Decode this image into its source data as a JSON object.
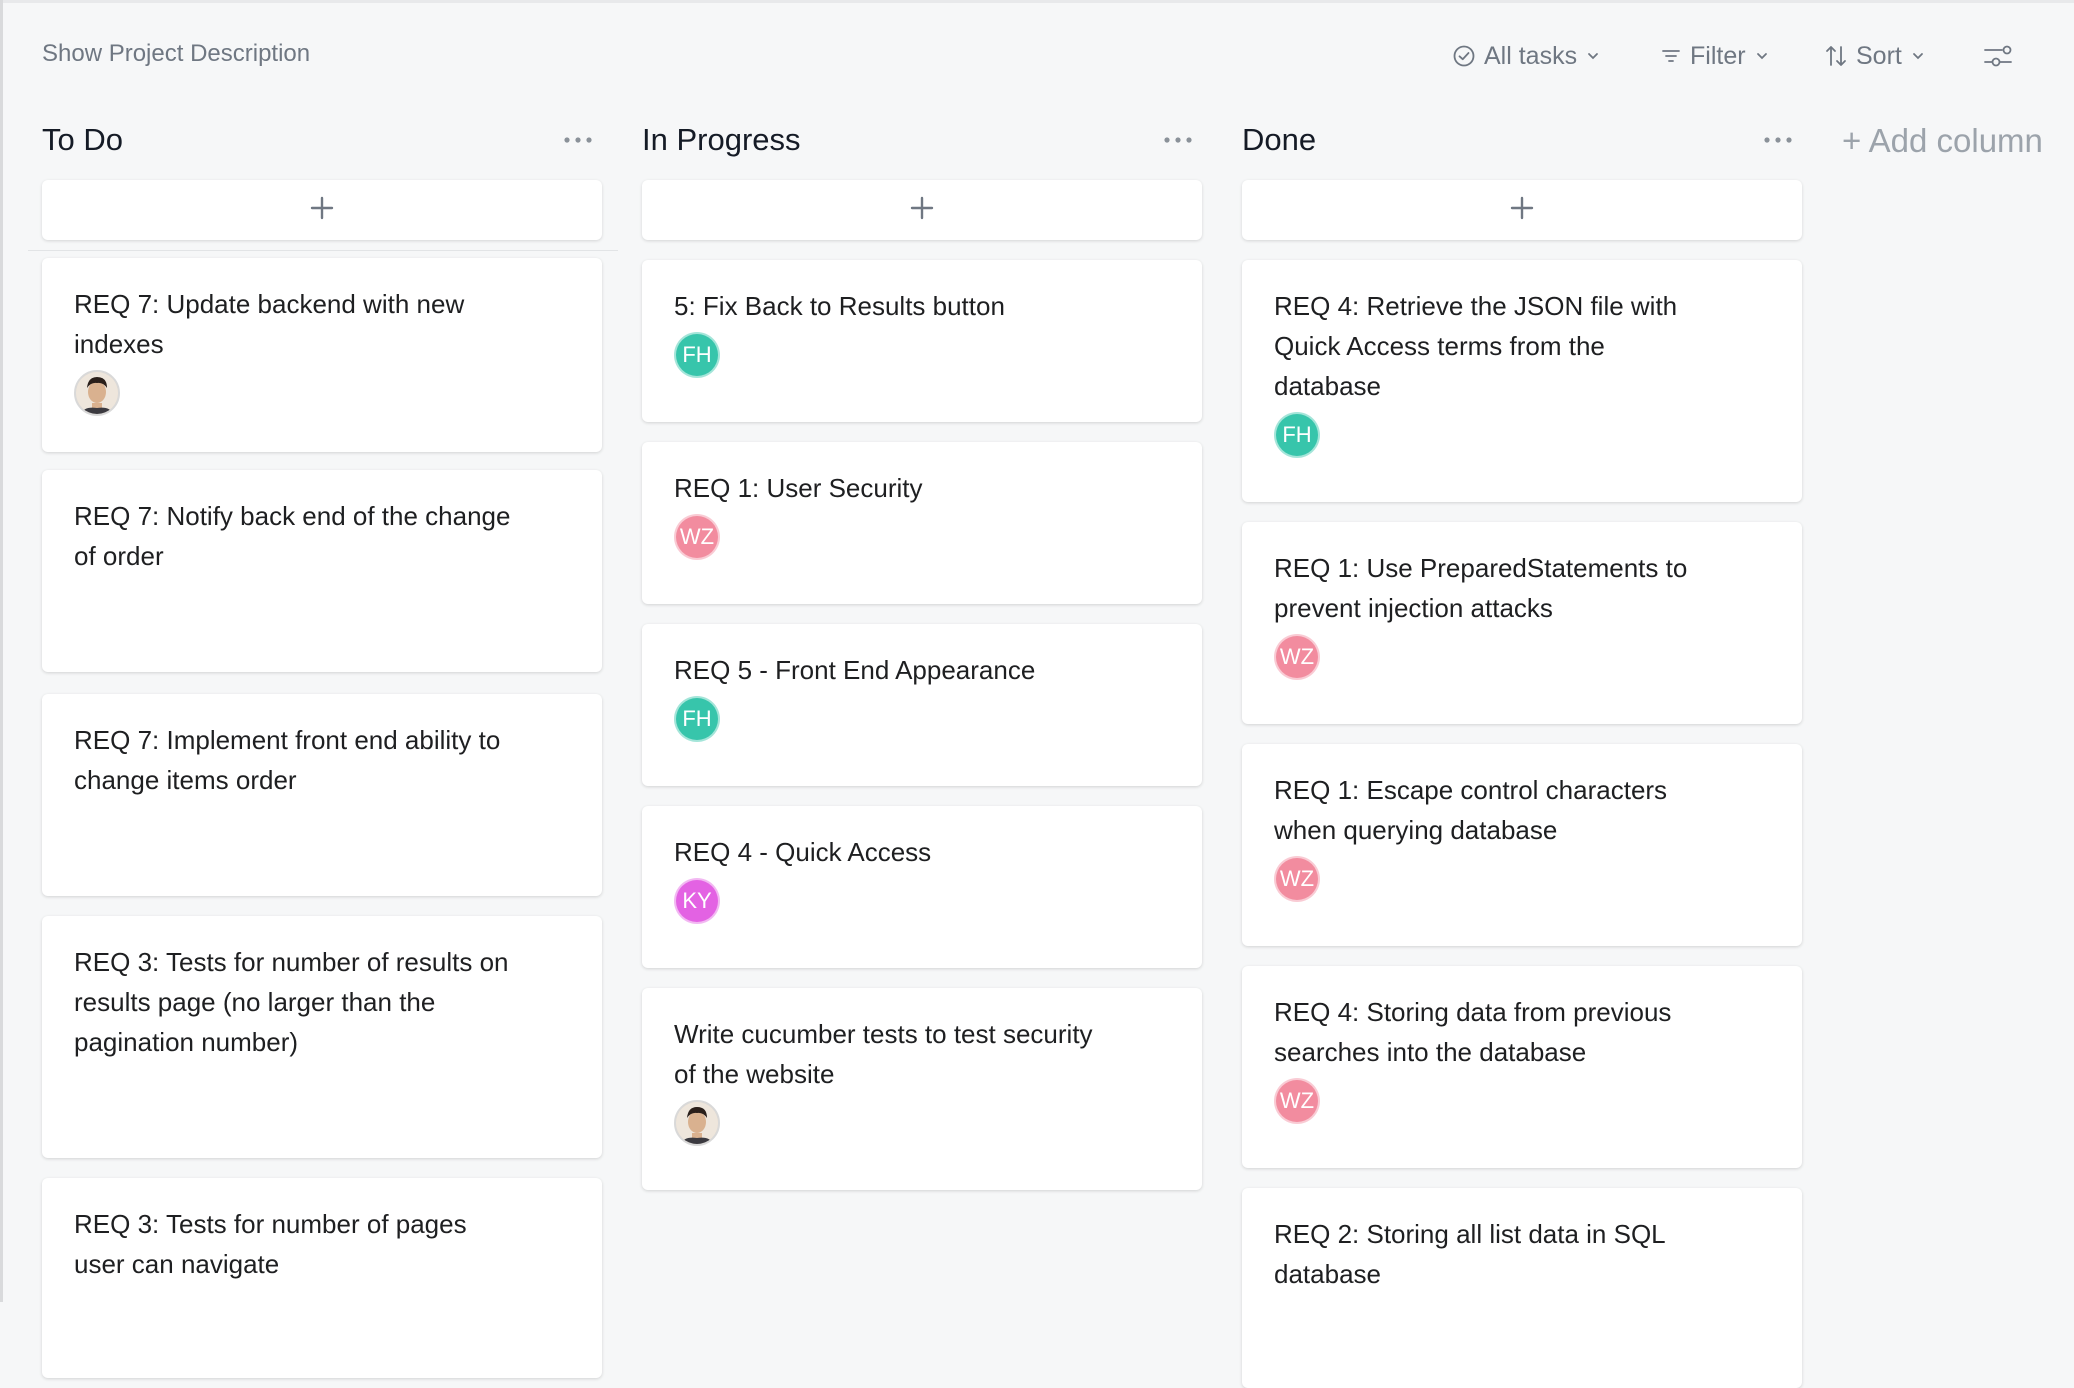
{
  "toolbar": {
    "show_description": "Show Project Description",
    "all_tasks": "All tasks",
    "filter": "Filter",
    "sort": "Sort",
    "customize_icon": "customize-icon"
  },
  "columns": [
    {
      "title": "To Do",
      "cards": [
        {
          "title": "REQ 7: Update backend with new indexes",
          "avatar": {
            "type": "photo"
          }
        },
        {
          "title": "REQ 7: Notify back end of the change of order",
          "avatar": null
        },
        {
          "title": "REQ 7: Implement front end ability to change items order",
          "avatar": null
        },
        {
          "title": "REQ 3: Tests for number of results on results page (no larger than the pagination number)",
          "avatar": null
        },
        {
          "title": "REQ 3: Tests for number of pages user can navigate",
          "avatar": null
        }
      ]
    },
    {
      "title": "In Progress",
      "cards": [
        {
          "title": "5: Fix Back to Results button",
          "avatar": {
            "type": "initials",
            "initials": "FH",
            "color": "#37c5ab"
          }
        },
        {
          "title": "REQ 1: User Security",
          "avatar": {
            "type": "initials",
            "initials": "WZ",
            "color": "#f28c9f"
          }
        },
        {
          "title": "REQ 5 - Front End Appearance",
          "avatar": {
            "type": "initials",
            "initials": "FH",
            "color": "#37c5ab"
          }
        },
        {
          "title": "REQ 4 - Quick Access",
          "avatar": {
            "type": "initials",
            "initials": "KY",
            "color": "#e362e3"
          }
        },
        {
          "title": "Write cucumber tests to test security of the website",
          "avatar": {
            "type": "photo"
          }
        }
      ]
    },
    {
      "title": "Done",
      "cards": [
        {
          "title": "REQ 4: Retrieve the JSON file with Quick Access terms from the database",
          "avatar": {
            "type": "initials",
            "initials": "FH",
            "color": "#37c5ab"
          }
        },
        {
          "title": "REQ 1: Use PreparedStatements to prevent injection attacks",
          "avatar": {
            "type": "initials",
            "initials": "WZ",
            "color": "#f28c9f"
          }
        },
        {
          "title": "REQ 1: Escape control characters when querying database",
          "avatar": {
            "type": "initials",
            "initials": "WZ",
            "color": "#f28c9f"
          }
        },
        {
          "title": "REQ 4: Storing data from previous searches into the database",
          "avatar": {
            "type": "initials",
            "initials": "WZ",
            "color": "#f28c9f"
          }
        },
        {
          "title": "REQ 2: Storing all list data in SQL database",
          "avatar": null
        }
      ]
    }
  ],
  "add_column": "+ Add column",
  "colors": {
    "accent_text": "#6f7782",
    "card_bg": "#ffffff",
    "board_bg": "#f6f7f8"
  }
}
